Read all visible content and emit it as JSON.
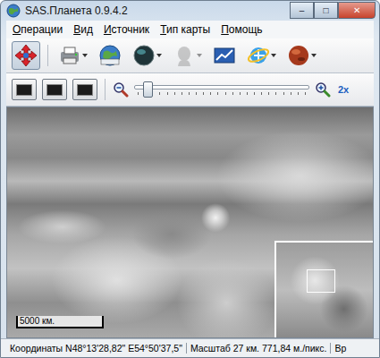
{
  "window": {
    "title": "SAS.Планета 0.9.4.2",
    "controls": [
      "–",
      "□",
      "✕"
    ]
  },
  "menu": [
    {
      "label": "Операции"
    },
    {
      "label": "Вид"
    },
    {
      "label": "Источник"
    },
    {
      "label": "Тип карты"
    },
    {
      "label": "Помощь"
    }
  ],
  "toolbar": [
    {
      "selected": true,
      "dropdown": false,
      "disabled": false
    },
    {
      "selected": false,
      "dropdown": true,
      "disabled": false
    },
    {
      "selected": false,
      "dropdown": false,
      "disabled": false
    },
    {
      "selected": false,
      "dropdown": true,
      "disabled": false
    },
    {
      "selected": false,
      "dropdown": true,
      "disabled": true
    },
    {
      "selected": false,
      "dropdown": false,
      "disabled": false
    },
    {
      "selected": false,
      "dropdown": true,
      "disabled": false
    },
    {
      "selected": false,
      "dropdown": true,
      "disabled": false
    }
  ],
  "view_buttons": [
    {
      "selected": false
    },
    {
      "selected": false
    },
    {
      "selected": false
    }
  ],
  "zoom": {
    "level": 0.07,
    "label": "2x"
  },
  "map": {
    "scale_label": "5000 км."
  },
  "status_bar": {
    "panels": [
      "Координаты N48°13'28,82\" E54°50'37,5\"",
      "Масштаб 27 км. 771,84 м./пикс.",
      "Вр"
    ]
  }
}
